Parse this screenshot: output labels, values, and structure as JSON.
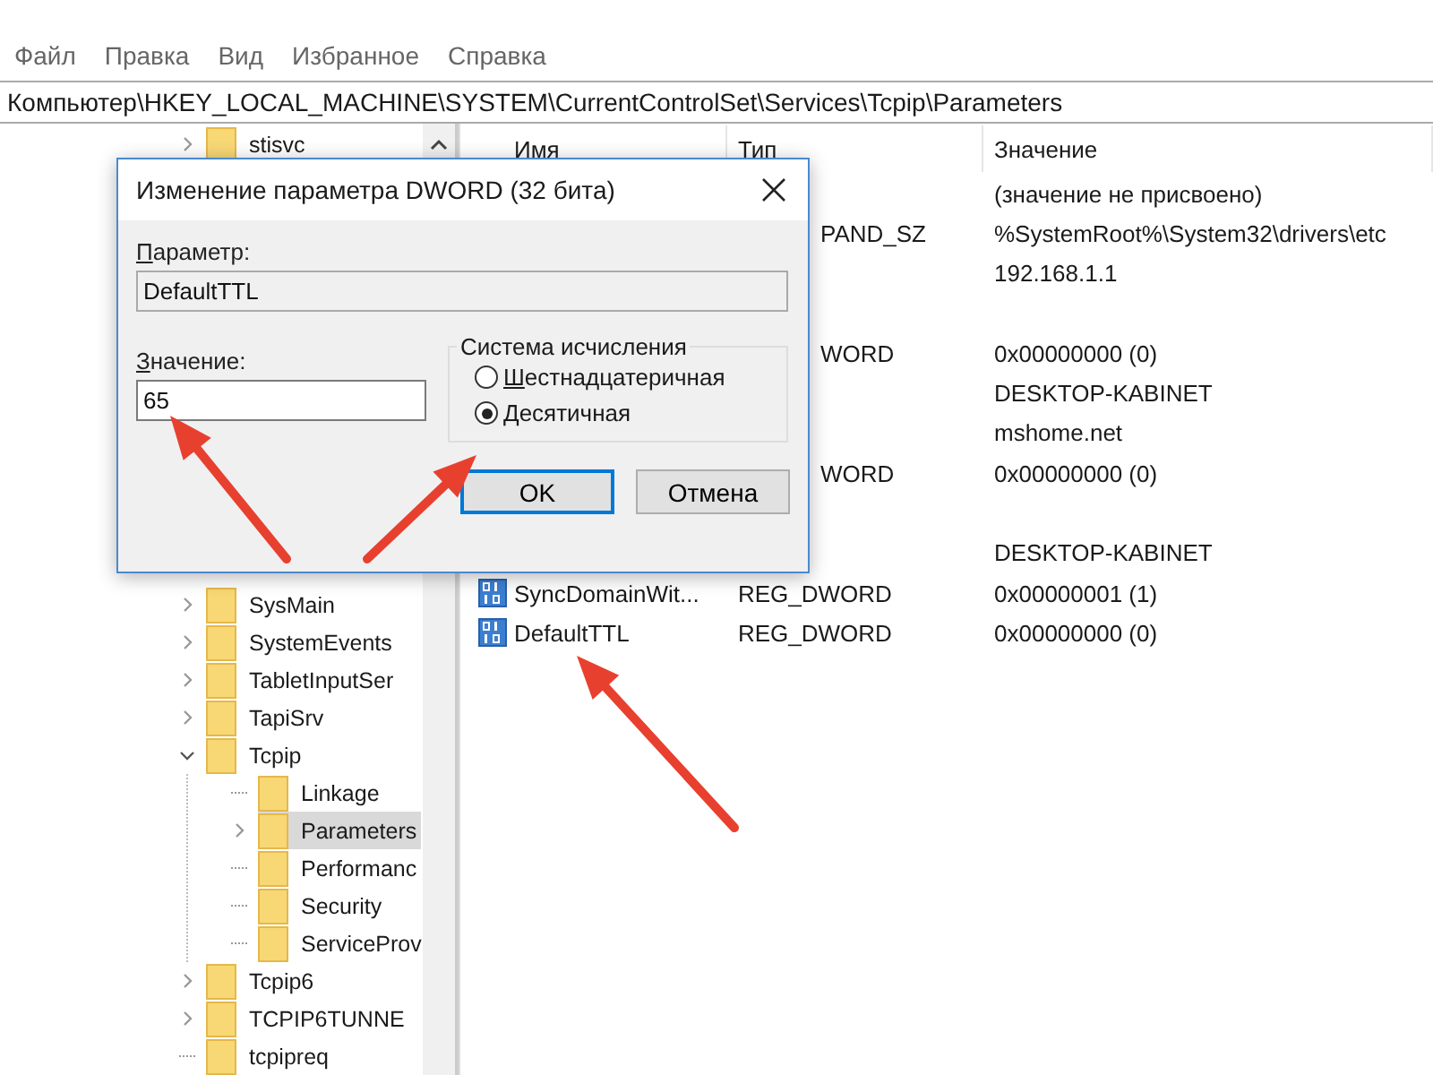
{
  "menu": [
    "Файл",
    "Правка",
    "Вид",
    "Избранное",
    "Справка"
  ],
  "address": "Компьютер\\HKEY_LOCAL_MACHINE\\SYSTEM\\CurrentControlSet\\Services\\Tcpip\\Parameters",
  "tree": {
    "above_dialog": [
      {
        "label": "stisvc",
        "has_children": true,
        "expanded": false,
        "selected": false
      }
    ],
    "below_dialog": [
      {
        "label": "SysMain",
        "has_children": true,
        "expanded": false,
        "selected": false
      },
      {
        "label": "SystemEvents",
        "has_children": true,
        "expanded": false,
        "selected": false
      },
      {
        "label": "TabletInputSer",
        "has_children": true,
        "expanded": false,
        "selected": false
      },
      {
        "label": "TapiSrv",
        "has_children": true,
        "expanded": false,
        "selected": false
      },
      {
        "label": "Tcpip",
        "has_children": true,
        "expanded": true,
        "selected": false,
        "children": [
          {
            "label": "Linkage",
            "has_children": false,
            "expanded": false,
            "selected": false
          },
          {
            "label": "Parameters",
            "has_children": true,
            "expanded": false,
            "selected": true
          },
          {
            "label": "Performanc",
            "has_children": false,
            "expanded": false,
            "selected": false
          },
          {
            "label": "Security",
            "has_children": false,
            "expanded": false,
            "selected": false
          },
          {
            "label": "ServiceProv",
            "has_children": false,
            "expanded": false,
            "selected": false
          }
        ]
      },
      {
        "label": "Tcpip6",
        "has_children": true,
        "expanded": false,
        "selected": false
      },
      {
        "label": "TCPIP6TUNNE",
        "has_children": true,
        "expanded": false,
        "selected": false
      },
      {
        "label": "tcpipreq",
        "has_children": false,
        "expanded": false,
        "selected": false
      }
    ]
  },
  "columns": [
    "Имя",
    "Тип",
    "Значение"
  ],
  "rows": [
    {
      "kind": "value",
      "value": "(значение не присвоено)"
    },
    {
      "kind": "value",
      "type": "PAND_SZ",
      "value": "%SystemRoot%\\System32\\drivers\\etc"
    },
    {
      "kind": "value",
      "value": "192.168.1.1"
    },
    {
      "kind": "covered"
    },
    {
      "kind": "value",
      "type": "WORD",
      "value": "0x00000000 (0)"
    },
    {
      "kind": "value",
      "value": "DESKTOP-KABINET"
    },
    {
      "kind": "value",
      "value": "mshome.net"
    },
    {
      "kind": "value",
      "type": "WORD",
      "value": "0x00000000 (0)"
    },
    {
      "kind": "covered"
    },
    {
      "kind": "value",
      "value": "DESKTOP-KABINET"
    },
    {
      "kind": "value",
      "name": "SyncDomainWit...",
      "type": "REG_DWORD",
      "value": "0x00000001 (1)"
    },
    {
      "kind": "value",
      "name": "DefaultTTL",
      "type": "REG_DWORD",
      "value": "0x00000000 (0)"
    }
  ],
  "dialog": {
    "title": "Изменение параметра DWORD (32 бита)",
    "parameter_label": "Параметр:",
    "parameter_value": "DefaultTTL",
    "parameter_disabled": true,
    "value_label": "Значение:",
    "value": "65",
    "base_group": "Система исчисления",
    "base_options": [
      {
        "label": "Шестнадцатеричная",
        "selected": false
      },
      {
        "label": "Десятичная",
        "selected": true
      }
    ],
    "buttons": [
      {
        "label": "OK",
        "default": true
      },
      {
        "label": "Отмена",
        "default": false
      }
    ]
  }
}
